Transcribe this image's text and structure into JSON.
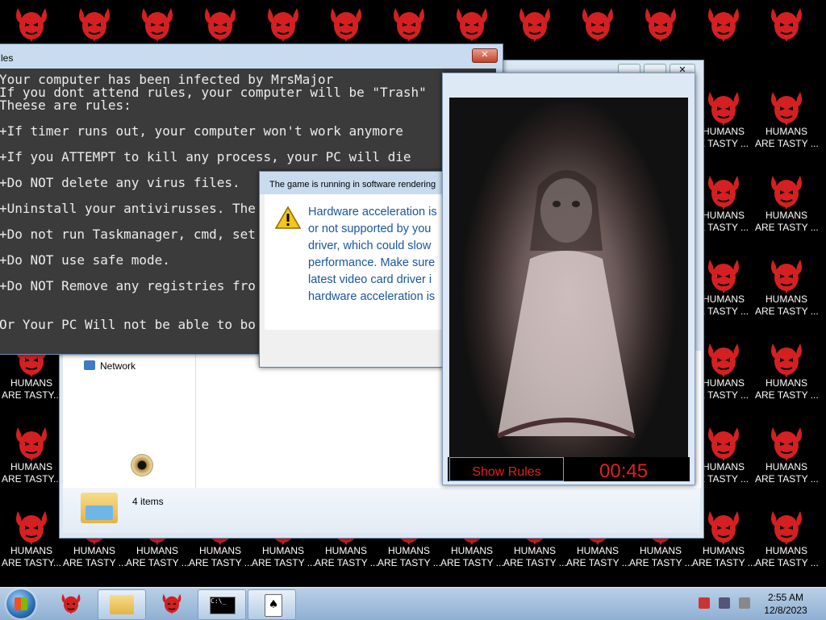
{
  "colors": {
    "accent_red": "#d42020",
    "timer_red": "#e02020",
    "dialog_text_blue": "#1a55a0",
    "console_bg": "#3b3b3b"
  },
  "desktop": {
    "icon_label_full": [
      "HUMANS",
      "ARE TASTY..."
    ],
    "icon_label_dots": [
      "HUMANS",
      "ARE TASTY ..."
    ],
    "icon_label_cut": [
      "HUMANS",
      "E TASTY ..."
    ],
    "top_labels": [
      "HUMANS",
      "HUMANS",
      "HUMANS",
      "HUMANS"
    ]
  },
  "rules_window": {
    "title": "les",
    "lines": [
      "Your computer has been infected by MrsMajor",
      "If you dont attend rules, your computer will be \"Trash\"",
      "Theese are rules:",
      "",
      "+If timer runs out, your computer won't work anymore",
      "",
      "+If you ATTEMPT to kill any process, your PC will die",
      "",
      "+Do NOT delete any virus files.",
      "",
      "+Uninstall your antivirusses. The",
      "",
      "+Do not run Taskmanager, cmd, set",
      "",
      "+Do NOT use safe mode.",
      "",
      "+Do NOT Remove any registries fro",
      "",
      "",
      "Or Your PC Will not be able to bo"
    ]
  },
  "explorer": {
    "network_label": "Network",
    "items_count": "4 items"
  },
  "game_dialog": {
    "title": "The game is running in software rendering",
    "message_lines": [
      "Hardware acceleration is",
      "or not supported by you",
      "driver, which could slow",
      "performance. Make sure",
      "latest video card driver i",
      "hardware acceleration is"
    ]
  },
  "video_window": {
    "show_rules_label": "Show Rules",
    "timer": "00:45"
  },
  "taskbar": {
    "time": "2:55 AM",
    "date": "12/8/2023"
  }
}
